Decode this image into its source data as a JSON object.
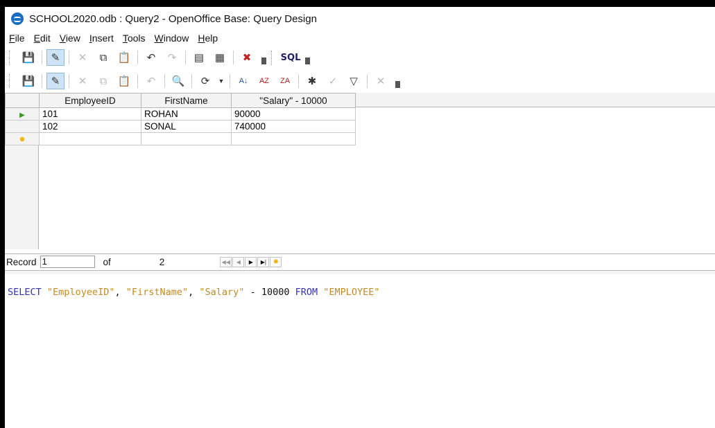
{
  "window": {
    "title": "SCHOOL2020.odb : Query2 - OpenOffice Base: Query Design"
  },
  "menu": [
    {
      "pre": "",
      "key": "F",
      "post": "ile"
    },
    {
      "pre": "",
      "key": "E",
      "post": "dit"
    },
    {
      "pre": "",
      "key": "V",
      "post": "iew"
    },
    {
      "pre": "",
      "key": "I",
      "post": "nsert"
    },
    {
      "pre": "",
      "key": "T",
      "post": "ools"
    },
    {
      "pre": "",
      "key": "W",
      "post": "indow"
    },
    {
      "pre": "",
      "key": "H",
      "post": "elp"
    }
  ],
  "toolbar1": {
    "icons": [
      "save-icon",
      "edit-mode-icon",
      "cut-icon",
      "copy-icon",
      "paste-icon",
      "undo-icon",
      "redo-icon",
      "run-query-icon",
      "clear-query-icon",
      "delete-icon",
      "sql-icon"
    ],
    "sql_label": "SQL"
  },
  "toolbar2": {
    "icons": [
      "save-record-icon",
      "edit-data-icon",
      "cut-icon",
      "copy-icon",
      "paste-icon",
      "undo-icon",
      "find-icon",
      "refresh-icon",
      "sort-ascending-icon",
      "sort-ascending-az-icon",
      "sort-descending-icon",
      "autofilter-icon",
      "standard-filter-icon",
      "apply-filter-icon",
      "remove-filter-icon"
    ]
  },
  "grid": {
    "columns": [
      "EmployeeID",
      "FirstName",
      "\"Salary\" - 10000"
    ],
    "rows": [
      [
        "101",
        "ROHAN",
        "90000"
      ],
      [
        "102",
        "SONAL",
        "740000"
      ]
    ]
  },
  "record_nav": {
    "label": "Record",
    "current": "1",
    "of_label": "of",
    "total": "2"
  },
  "sql": {
    "select": "SELECT",
    "col1": "\"EmployeeID\"",
    "sep1": ", ",
    "col2": "\"FirstName\"",
    "sep2": ", ",
    "col3": "\"Salary\"",
    "minus": " - ",
    "num": "10000",
    "from": "FROM",
    "table": "\"EMPLOYEE\""
  },
  "colors": {
    "keyword": "#3030c8",
    "string": "#c88a1e",
    "accent": "#1a6fc0"
  }
}
